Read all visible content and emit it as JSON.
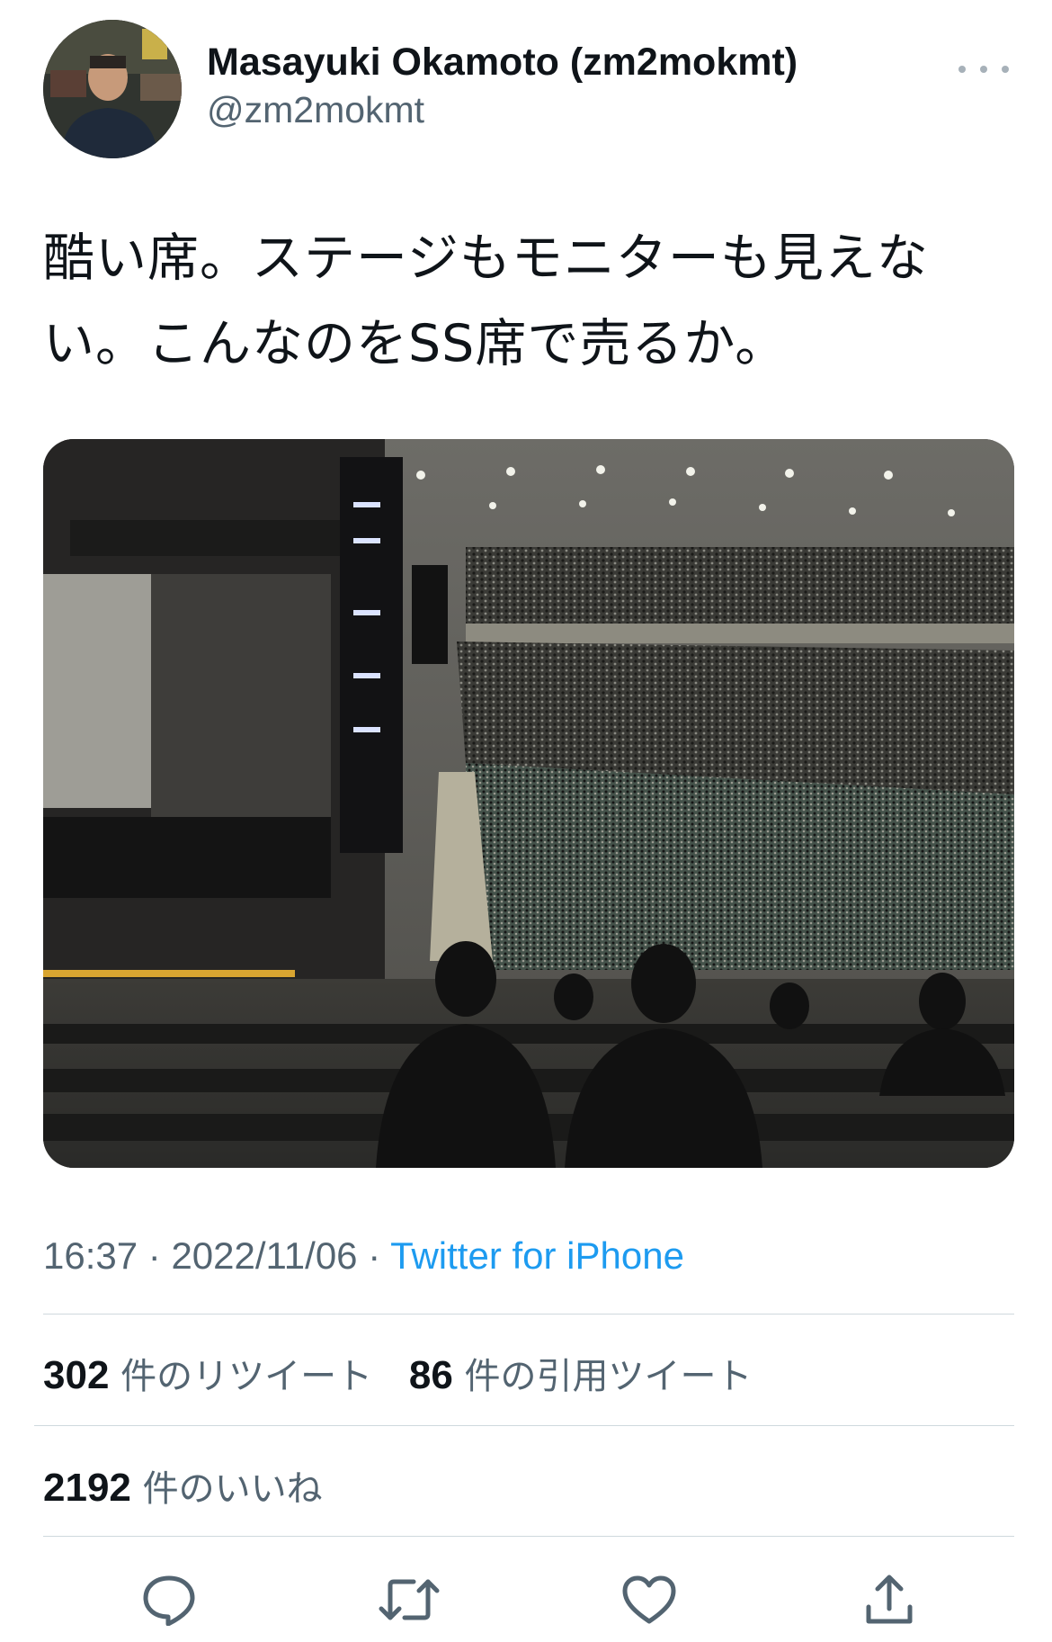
{
  "author": {
    "display_name": "Masayuki Okamoto (zm2mokmt)",
    "handle": "@zm2mokmt"
  },
  "tweet": {
    "text_lines": [
      "酷い席。ステージもモニターも見えな",
      "い。こんなのをSS席で売るか。"
    ]
  },
  "meta": {
    "time": "16:37",
    "separator": "·",
    "date": "2022/11/06",
    "source": "Twitter for iPhone"
  },
  "stats": {
    "retweets": {
      "count": "302",
      "label": "件のリツイート"
    },
    "quotes": {
      "count": "86",
      "label": "件の引用ツイート"
    },
    "likes": {
      "count": "2192",
      "label": "件のいいね"
    }
  },
  "icons": {
    "more": "more-dots-icon",
    "reply": "reply-icon",
    "retweet": "retweet-icon",
    "like": "heart-icon",
    "share": "share-icon"
  },
  "colors": {
    "link": "#1d9bf0",
    "secondary_text": "#536471",
    "primary_text": "#0f1419"
  }
}
